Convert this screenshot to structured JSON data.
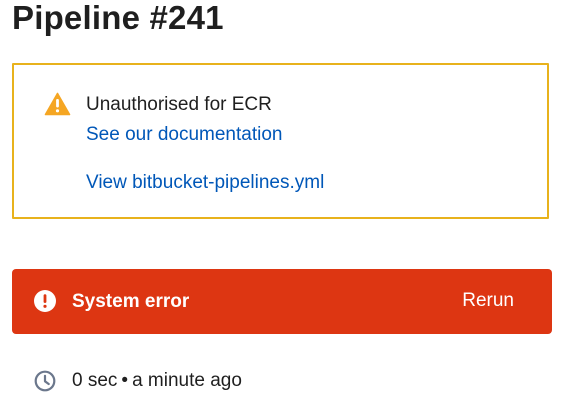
{
  "page": {
    "title": "Pipeline #241"
  },
  "warning": {
    "message": "Unauthorised for ECR",
    "documentation_link": "See our documentation",
    "yml_link": "View bitbucket-pipelines.yml",
    "icon": "warning-triangle-icon",
    "border_color": "#e8b21c",
    "icon_color": "#f5a623"
  },
  "status": {
    "label": "System error",
    "rerun_label": "Rerun",
    "icon": "error-circle-icon",
    "background_color": "#dd3612"
  },
  "meta": {
    "duration": "0 sec",
    "separator": "•",
    "when": "a minute ago",
    "icon": "clock-icon"
  }
}
